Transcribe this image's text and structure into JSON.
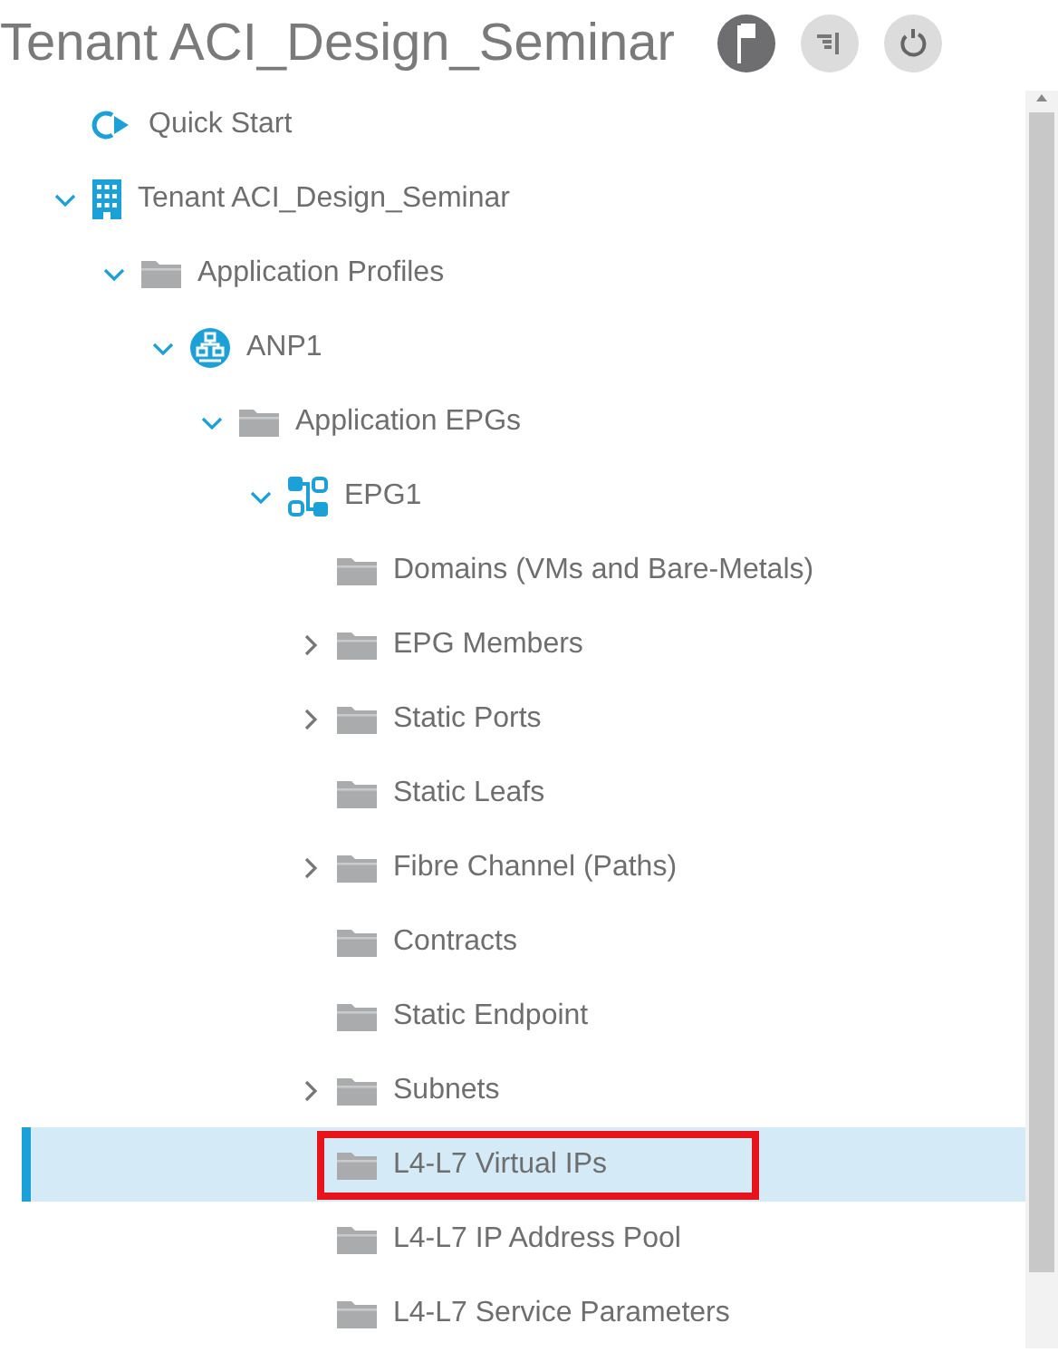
{
  "header": {
    "title": "Tenant ACI_Design_Seminar"
  },
  "tree": [
    {
      "kind": "quickstart",
      "label": "Quick Start",
      "selected": false
    },
    {
      "kind": "tenant",
      "label": "Tenant ACI_Design_Seminar",
      "selected": false,
      "expanded": true,
      "children": [
        {
          "kind": "folder",
          "label": "Application Profiles",
          "selected": false,
          "expanded": true,
          "children": [
            {
              "kind": "anp",
              "label": "ANP1",
              "selected": false,
              "expanded": true,
              "children": [
                {
                  "kind": "folder",
                  "label": "Application EPGs",
                  "selected": false,
                  "expanded": true,
                  "children": [
                    {
                      "kind": "epg",
                      "label": "EPG1",
                      "selected": false,
                      "expanded": true,
                      "children": [
                        {
                          "kind": "folder",
                          "label": "Domains (VMs and Bare-Metals)",
                          "selected": false
                        },
                        {
                          "kind": "folder",
                          "label": "EPG Members",
                          "selected": false,
                          "expanded": false
                        },
                        {
                          "kind": "folder",
                          "label": "Static Ports",
                          "selected": false,
                          "expanded": false
                        },
                        {
                          "kind": "folder",
                          "label": "Static Leafs",
                          "selected": false
                        },
                        {
                          "kind": "folder",
                          "label": "Fibre Channel (Paths)",
                          "selected": false,
                          "expanded": false
                        },
                        {
                          "kind": "folder",
                          "label": "Contracts",
                          "selected": false
                        },
                        {
                          "kind": "folder",
                          "label": "Static Endpoint",
                          "selected": false
                        },
                        {
                          "kind": "folder",
                          "label": "Subnets",
                          "selected": false,
                          "expanded": false
                        },
                        {
                          "kind": "folder",
                          "label": "L4-L7 Virtual IPs",
                          "selected": true,
                          "callout": true
                        },
                        {
                          "kind": "folder",
                          "label": "L4-L7 IP Address Pool",
                          "selected": false
                        },
                        {
                          "kind": "folder",
                          "label": "L4-L7 Service Parameters",
                          "selected": false
                        }
                      ]
                    }
                  ]
                }
              ]
            }
          ]
        }
      ]
    }
  ]
}
